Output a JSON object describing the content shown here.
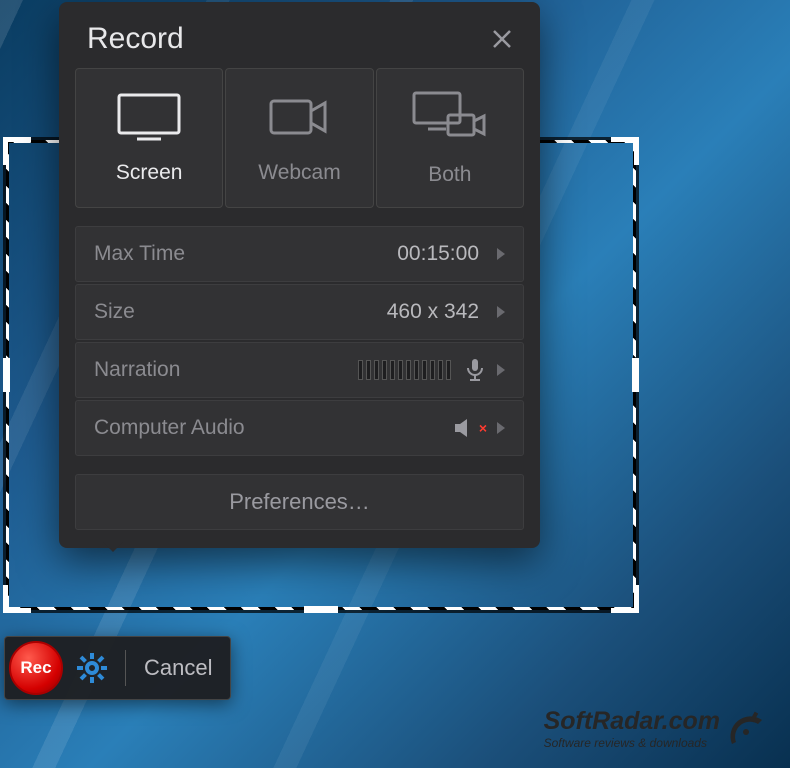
{
  "panel": {
    "title": "Record",
    "sources": {
      "screen": "Screen",
      "webcam": "Webcam",
      "both": "Both"
    },
    "rows": {
      "maxtime": {
        "label": "Max Time",
        "value": "00:15:00"
      },
      "size": {
        "label": "Size",
        "value": "460 x 342"
      },
      "narration": {
        "label": "Narration"
      },
      "compaudio": {
        "label": "Computer Audio"
      }
    },
    "preferences": "Preferences…"
  },
  "toolbar": {
    "rec": "Rec",
    "cancel": "Cancel"
  },
  "watermark": {
    "line1": "SoftRadar.com",
    "line2": "Software reviews & downloads"
  }
}
